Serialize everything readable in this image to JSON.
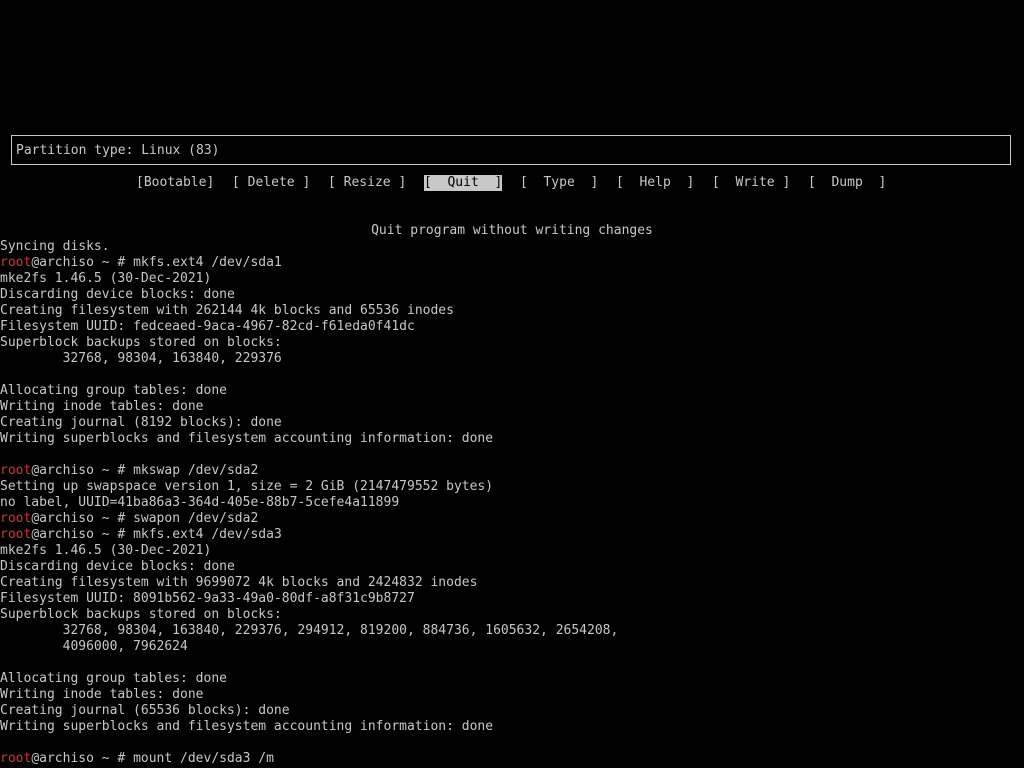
{
  "partition_type": "Partition type: Linux (83)",
  "menu": {
    "bootable": "[Bootable]",
    "delete": "[ Delete ]",
    "resize": "[ Resize ]",
    "quit": "[  Quit  ]",
    "type": "[  Type  ]",
    "help": "[  Help  ]",
    "write": "[  Write ]",
    "dump": "[  Dump  ]"
  },
  "help_text": "Quit program without writing changes",
  "prompt": {
    "user": "root",
    "host": "@archiso ~ # "
  },
  "terminal": {
    "syncing": "Syncing disks.",
    "cmd1": "mkfs.ext4 /dev/sda1",
    "out1_1": "mke2fs 1.46.5 (30-Dec-2021)",
    "out1_2": "Discarding device blocks: done",
    "out1_3": "Creating filesystem with 262144 4k blocks and 65536 inodes",
    "out1_4": "Filesystem UUID: fedceaed-9aca-4967-82cd-f61eda0f41dc",
    "out1_5": "Superblock backups stored on blocks:",
    "out1_6": "        32768, 98304, 163840, 229376",
    "out1_7": "Allocating group tables: done",
    "out1_8": "Writing inode tables: done",
    "out1_9": "Creating journal (8192 blocks): done",
    "out1_10": "Writing superblocks and filesystem accounting information: done",
    "cmd2": "mkswap /dev/sda2",
    "out2_1": "Setting up swapspace version 1, size = 2 GiB (2147479552 bytes)",
    "out2_2": "no label, UUID=41ba86a3-364d-405e-88b7-5cefe4a11899",
    "cmd3": "swapon /dev/sda2",
    "cmd4": "mkfs.ext4 /dev/sda3",
    "out4_1": "mke2fs 1.46.5 (30-Dec-2021)",
    "out4_2": "Discarding device blocks: done",
    "out4_3": "Creating filesystem with 9699072 4k blocks and 2424832 inodes",
    "out4_4": "Filesystem UUID: 8091b562-9a33-49a0-80df-a8f31c9b8727",
    "out4_5": "Superblock backups stored on blocks:",
    "out4_6": "        32768, 98304, 163840, 229376, 294912, 819200, 884736, 1605632, 2654208,",
    "out4_7": "        4096000, 7962624",
    "out4_8": "Allocating group tables: done",
    "out4_9": "Writing inode tables: done",
    "out4_10": "Creating journal (65536 blocks): done",
    "out4_11": "Writing superblocks and filesystem accounting information: done",
    "cmd5": "mount /dev/sda3 /m"
  },
  "colors": {
    "background": "#000000",
    "text": "#c8c8c8",
    "prompt_user": "#e0302b"
  }
}
